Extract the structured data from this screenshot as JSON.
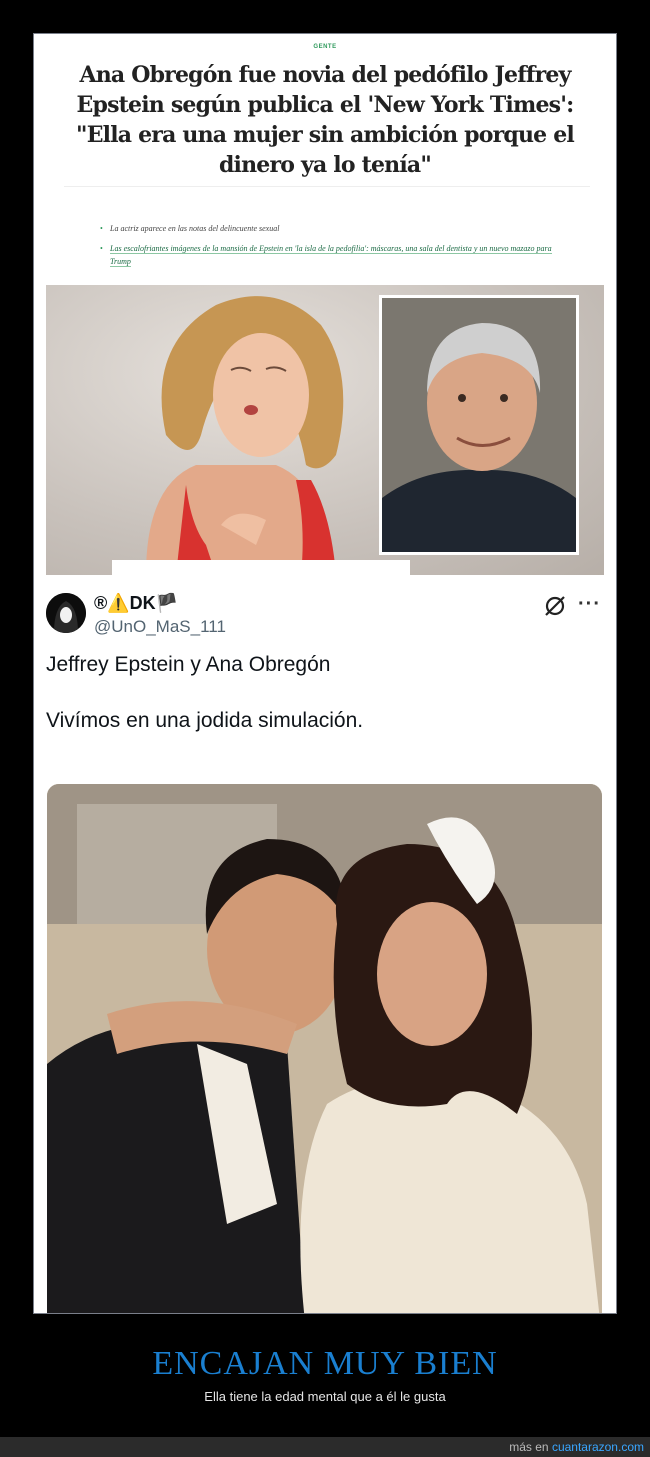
{
  "article": {
    "section": "GENTE",
    "headline": "Ana Obregón fue novia del pedófilo Jeffrey Epstein según publica el 'New York Times': \"Ella era una mujer sin ambición porque el dinero ya lo tenía\"",
    "bullets": [
      "La actriz aparece en las notas del delincuente sexual",
      "Las escalofriantes imágenes de la mansión de Epstein en 'la isla de la pedofilia': máscaras, una sala del dentista y un nuevo mazazo para Trump"
    ]
  },
  "tweet": {
    "display_name": "®⚠️DK🏴",
    "handle": "@UnO_MaS_111",
    "text": "Jeffrey Epstein y Ana Obregón\n\nVivímos en una jodida simulación."
  },
  "bottom": {
    "title": "ENCAJAN MUY BIEN",
    "subtitle": "Ella tiene la edad mental que a él le gusta"
  },
  "footer": {
    "prefix": "más en",
    "link": "cuantarazon.com"
  },
  "colors": {
    "accent_green": "#2f9a5c",
    "title_blue": "#1a7fd0",
    "footer_link": "#39a6ff"
  }
}
